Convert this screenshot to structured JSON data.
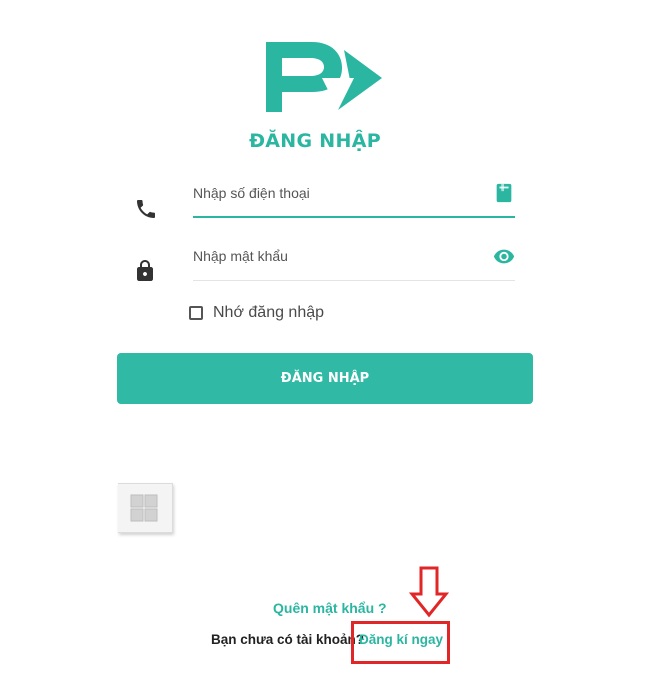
{
  "brand": {
    "logo_icon": "p-arrow-logo",
    "accent_color": "#2bb6a2"
  },
  "screen": {
    "title": "ĐĂNG NHẬP"
  },
  "phone_field": {
    "placeholder": "Nhập số điện thoại",
    "value": "",
    "left_icon": "phone-icon",
    "right_icon": "contacts-book-icon"
  },
  "password_field": {
    "placeholder": "Nhập mật khẩu",
    "value": "",
    "left_icon": "lock-icon",
    "right_icon": "eye-icon"
  },
  "remember": {
    "label": "Nhớ đăng nhập",
    "checked": false
  },
  "login_button": {
    "label": "ĐĂNG NHẬP"
  },
  "floating_button": {
    "icon": "grid-icon"
  },
  "footer": {
    "forgot_password": "Quên mật khẩu ?",
    "no_account": "Bạn chưa có tài khoản?",
    "register_link": "Đăng kí ngay"
  },
  "annotation": {
    "arrow_icon": "down-arrow-icon",
    "color": "#e02626"
  }
}
